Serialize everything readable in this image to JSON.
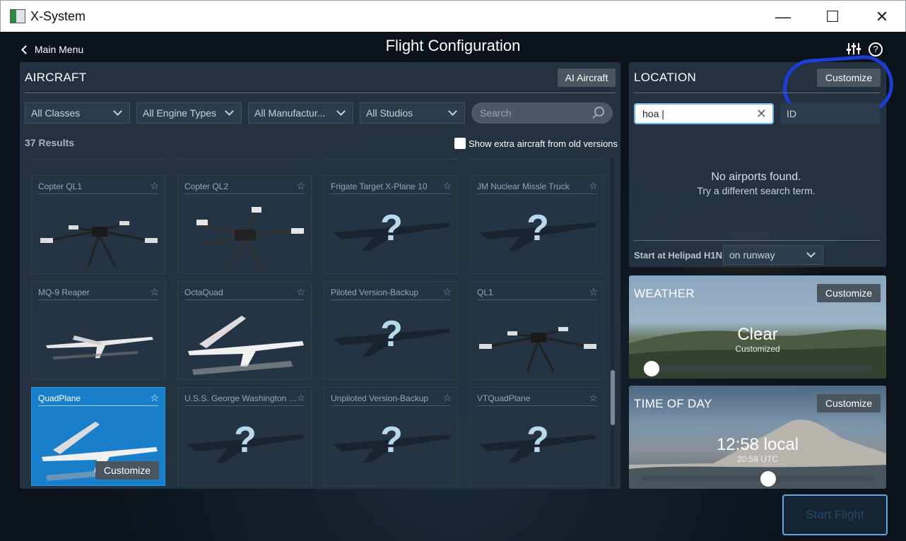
{
  "window": {
    "title": "X-System",
    "minimize_glyph": "—",
    "maximize_glyph": "☐",
    "close_glyph": "✕"
  },
  "header": {
    "back_label": "Main Menu",
    "title": "Flight Configuration",
    "settings_icon": "sliders-icon",
    "help_icon": "help-icon",
    "help_glyph": "?"
  },
  "aircraft": {
    "title": "AIRCRAFT",
    "ai_button": "AI Aircraft",
    "filters": [
      "All Classes",
      "All Engine Types",
      "All Manufactur...",
      "All Studios"
    ],
    "search_placeholder": "Search",
    "results": "37 Results",
    "old_versions_label": "Show extra aircraft from old versions",
    "star_glyph": "☆",
    "qmark_glyph": "?",
    "cards": [
      {
        "name": "Copter QL1",
        "thumb": "quadcopter"
      },
      {
        "name": "Copter QL2",
        "thumb": "quadcopter-large"
      },
      {
        "name": "Frigate Target X-Plane 10",
        "thumb": "unknown"
      },
      {
        "name": "JM Nuclear Missle Truck",
        "thumb": "unknown"
      },
      {
        "name": "MQ-9 Reaper",
        "thumb": "drone-plane"
      },
      {
        "name": "OctaQuad",
        "thumb": "vtol-plane"
      },
      {
        "name": "Piloted Version-Backup",
        "thumb": "unknown"
      },
      {
        "name": "QL1",
        "thumb": "quadcopter"
      },
      {
        "name": "QuadPlane",
        "thumb": "vtol-plane",
        "selected": true
      },
      {
        "name": "U.S.S. George Washington (...",
        "thumb": "unknown"
      },
      {
        "name": "Unpiloted Version-Backup",
        "thumb": "unknown"
      },
      {
        "name": "VTQuadPlane",
        "thumb": "unknown"
      }
    ],
    "customize_label": "Customize"
  },
  "location": {
    "title": "LOCATION",
    "customize_label": "Customize",
    "search_value": "hoa |",
    "clear_glyph": "✕",
    "id_select": "ID",
    "no_airports": "No airports found.",
    "hint": "Try a different search term.",
    "start_at": "Start at Helipad H1N,",
    "start_option": "on runway"
  },
  "weather": {
    "title": "WEATHER",
    "customize_label": "Customize",
    "value": "Clear",
    "subvalue": "Customized",
    "level": 0.0
  },
  "time_of_day": {
    "title": "TIME OF DAY",
    "customize_label": "Customize",
    "value": "12:58 local",
    "subvalue": "20:58 UTC",
    "level": 0.54
  },
  "start_flight": "Start Flight",
  "colors": {
    "accent": "#1a7fca",
    "annotation": "#1a3fd8",
    "panel": "#263545"
  }
}
